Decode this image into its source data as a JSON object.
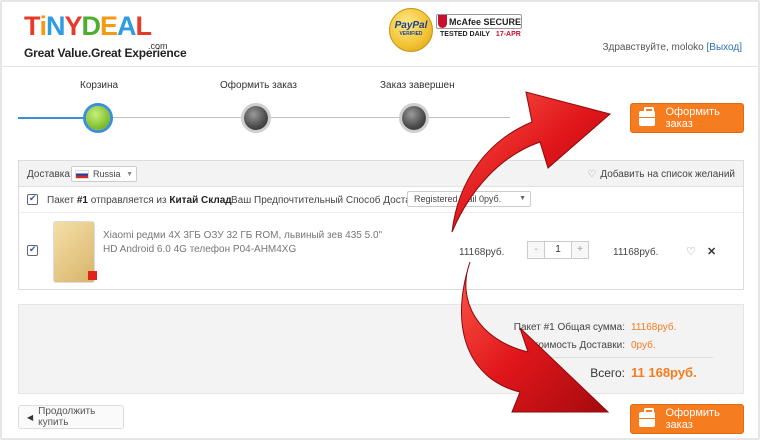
{
  "header": {
    "logo_letters": [
      {
        "ch": "T",
        "color": "#e63a2b"
      },
      {
        "ch": "i",
        "color": "#f29a12"
      },
      {
        "ch": "N",
        "color": "#2f9be0"
      },
      {
        "ch": "Y",
        "color": "#e63a2b"
      },
      {
        "ch": "D",
        "color": "#4fae32"
      },
      {
        "ch": "E",
        "color": "#f29a12"
      },
      {
        "ch": "A",
        "color": "#2f9be0"
      },
      {
        "ch": "L",
        "color": "#e63a2b"
      }
    ],
    "logo_com": ".com",
    "slogan": "Great Value.Great Experience",
    "paypal_name": "PayPal",
    "paypal_sub": "VERIFIED",
    "mcafee_name": "McAfee SECURE",
    "mcafee_tested": "TESTED DAILY",
    "mcafee_date": "17-APR",
    "greeting": "Здравствуйте, moloko",
    "logout": "[Выход]"
  },
  "steps": [
    {
      "label": "Корзина",
      "state": "active"
    },
    {
      "label": "Оформить заказ",
      "state": "pending"
    },
    {
      "label": "Заказ завершен",
      "state": "pending"
    }
  ],
  "checkout_button_label": "Оформить заказ",
  "cart": {
    "shipping_label": "Доставка:",
    "country": "Russia",
    "wishlist_label": "Добавить на список желаний",
    "package_prefix": "Пакет",
    "package_number": "#1",
    "package_middle": "отправляется из",
    "package_warehouse": "Китай Склад",
    "preferred_shipping_label": "Ваш Предпочтительный Способ Доставки",
    "shipping_method": "Registered Mail 0руб.",
    "item": {
      "title": "Xiaomi редми 4X 3ГБ ОЗУ 32 ГБ ROM, львиный зев 435 5.0\" HD Android 6.0 4G телефон P04-AHM4XG",
      "price": "11168руб.",
      "quantity": "1",
      "qty_minus": "-",
      "qty_plus": "+",
      "total": "11168руб."
    }
  },
  "summary": {
    "package_total_label": "Пакет #1 Общая сумма:",
    "package_total_value": "11168руб.",
    "shipping_cost_label": "Стоимость Доставки:",
    "shipping_cost_value": "0руб.",
    "grand_total_label": "Всего:",
    "grand_total_value": "11 168руб."
  },
  "continue_label": "Продолжить купить",
  "colors": {
    "accent_orange": "#f57c1f",
    "step_active_blue": "#3a8fd8",
    "link_blue": "#2f6fb4",
    "arrow_red": "#e0161b"
  }
}
